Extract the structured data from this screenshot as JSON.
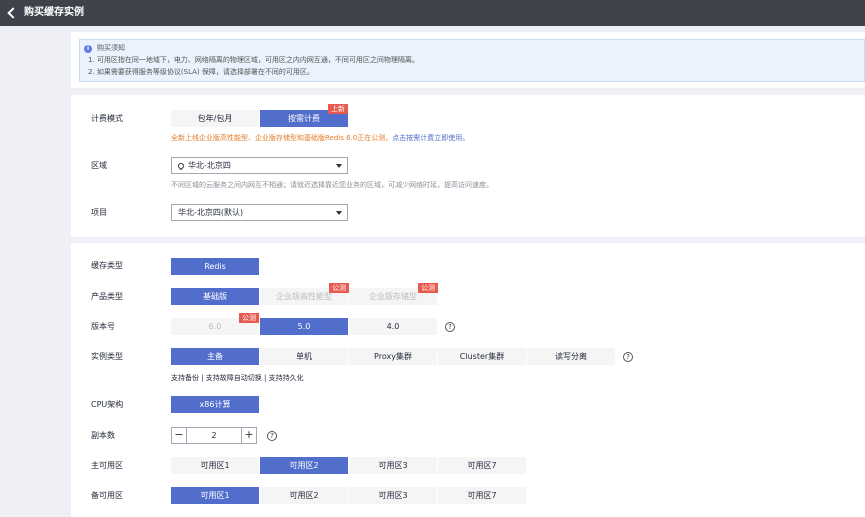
{
  "header": {
    "title": "购买缓存实例"
  },
  "notice": {
    "title": "购买须知",
    "lines": [
      "1. 可用区指在同一地域下，电力、网络隔离的物理区域，可用区之内内网互通，不同可用区之间物理隔离。",
      "2. 如果需要获得服务等级协议(SLA) 保障，请选择部署在不同的可用区。"
    ]
  },
  "billing": {
    "label": "计费模式",
    "options": [
      "包年/包月",
      "按需计费"
    ],
    "new_badge": "上新",
    "promo_text": "全新上线企业版高性能型、企业版存储型和基础版Redis 6.0正在公测，",
    "promo_link": "点击按需计费立即使用。"
  },
  "region": {
    "label": "区域",
    "value": "华北-北京四",
    "hint": "不同区域的云服务之间内网互不相通；请就近选择靠近您业务的区域，可减少网络时延，提高访问速度。"
  },
  "project": {
    "label": "项目",
    "value": "华北-北京四(默认)"
  },
  "cache_type": {
    "label": "缓存类型",
    "value": "Redis"
  },
  "product_type": {
    "label": "产品类型",
    "options": [
      "基础版",
      "企业版高性能型",
      "企业版存储型"
    ],
    "badge": "公测"
  },
  "version": {
    "label": "版本号",
    "options": [
      "6.0",
      "5.0",
      "4.0"
    ],
    "badge": "公测"
  },
  "instance_type": {
    "label": "实例类型",
    "options": [
      "主备",
      "单机",
      "Proxy集群",
      "Cluster集群",
      "读写分离"
    ],
    "features": "支持备份 | 支持故障自动切换 | 支持持久化"
  },
  "cpu": {
    "label": "CPU架构",
    "value": "x86计算"
  },
  "replicas": {
    "label": "副本数",
    "value": "2",
    "minus": "−",
    "plus": "+"
  },
  "primary_az": {
    "label": "主可用区",
    "options": [
      "可用区1",
      "可用区2",
      "可用区3",
      "可用区7"
    ]
  },
  "standby_az": {
    "label": "备可用区",
    "options": [
      "可用区1",
      "可用区2",
      "可用区3",
      "可用区7"
    ]
  },
  "help_glyph": "?",
  "info_glyph": "i",
  "colors": {
    "accent": "#526ecc",
    "badge": "#e8594f",
    "promo": "#e37d29",
    "link": "#526ecc",
    "hint": "#8a8e99"
  }
}
